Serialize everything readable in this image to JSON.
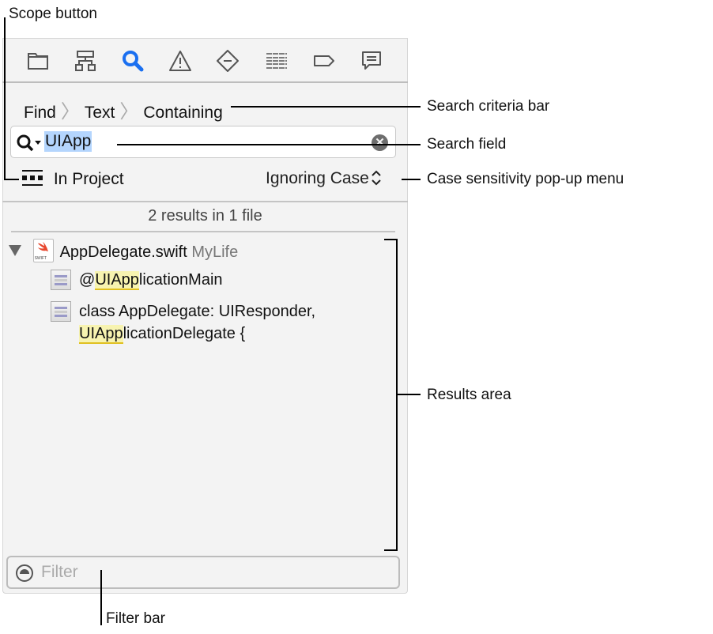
{
  "toolbar": {
    "icons": [
      "folder-icon",
      "hierarchy-icon",
      "search-icon",
      "warning-icon",
      "test-diamond-icon",
      "debug-list-icon",
      "breakpoint-tag-icon",
      "report-bubble-icon"
    ],
    "selected": "search-icon",
    "accent": "#1a6ff0"
  },
  "criteria": {
    "find": "Find",
    "text": "Text",
    "containing": "Containing"
  },
  "search": {
    "value": "UIApp"
  },
  "scope": {
    "label": "In Project"
  },
  "case": {
    "label": "Ignoring Case"
  },
  "results": {
    "summary": "2 results in 1 file",
    "file": {
      "name": "AppDelegate.swift",
      "project": "MyLife",
      "badge": "SWIFT"
    },
    "matches": [
      {
        "pre": "@",
        "match": "UIApp",
        "match2": "licationMain"
      },
      {
        "line1": "class AppDelegate: UIResponder,",
        "match": "UIApp",
        "rest": "licationDelegate {"
      }
    ]
  },
  "filter": {
    "placeholder": "Filter"
  },
  "callouts": {
    "scope": "Scope button",
    "criteria": "Search criteria bar",
    "field": "Search field",
    "case": "Case sensitivity pop-up menu",
    "results": "Results area",
    "filter": "Filter bar"
  }
}
